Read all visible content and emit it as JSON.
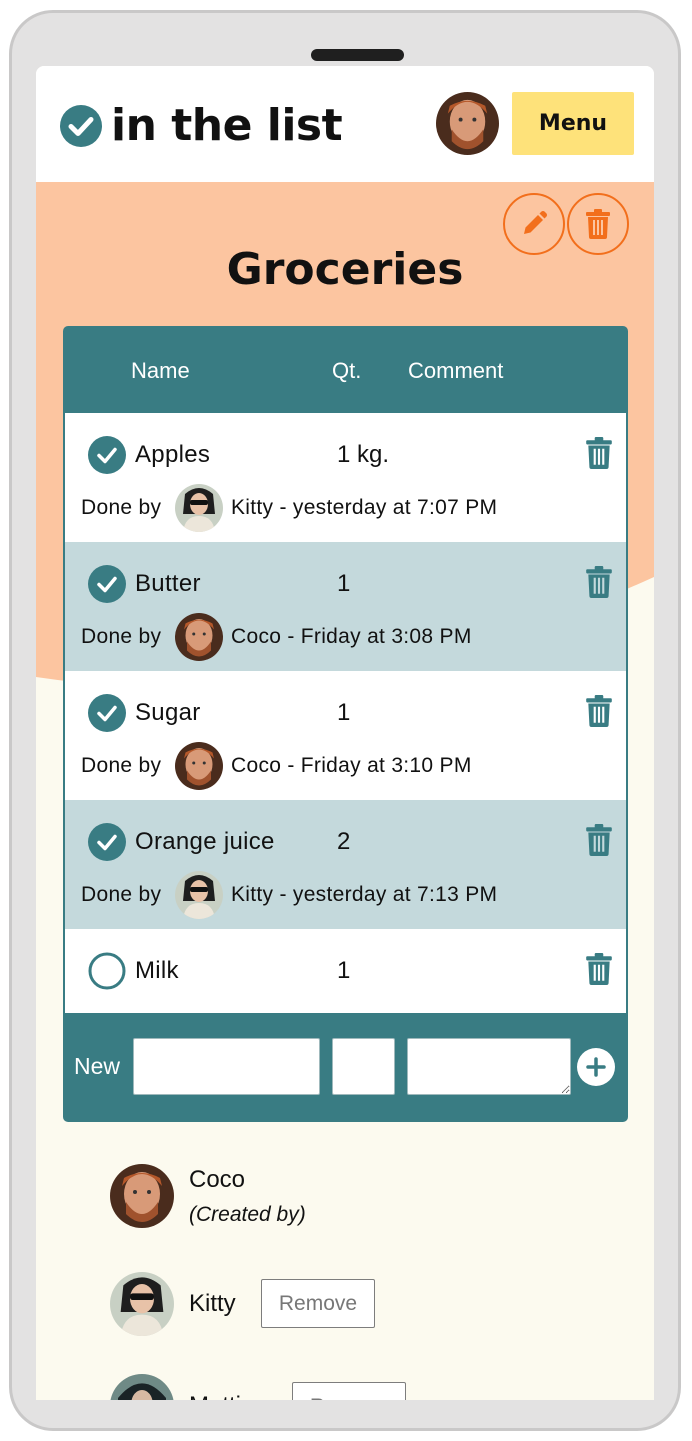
{
  "app": {
    "logo_text": "in the list",
    "menu_label": "Menu"
  },
  "list": {
    "title": "Groceries",
    "edit_icon": "pencil-icon",
    "delete_icon": "trash-icon"
  },
  "table": {
    "headers": {
      "name": "Name",
      "qty": "Qt.",
      "comment": "Comment"
    },
    "done_by_label": "Done by",
    "items": [
      {
        "name": "Apples",
        "qty": "1 kg.",
        "done": true,
        "done_text": "Kitty - yesterday at 7:07 PM"
      },
      {
        "name": "Butter",
        "qty": "1",
        "done": true,
        "done_text": "Coco - Friday at 3:08 PM"
      },
      {
        "name": "Sugar",
        "qty": "1",
        "done": true,
        "done_text": "Coco - Friday at 3:10 PM"
      },
      {
        "name": "Orange juice",
        "qty": "2",
        "done": true,
        "done_text": "Kitty - yesterday at 7:13 PM"
      },
      {
        "name": "Milk",
        "qty": "1",
        "done": false,
        "done_text": ""
      }
    ],
    "new_row": {
      "label": "New",
      "name_value": "",
      "qty_value": "",
      "comment_value": ""
    }
  },
  "members": [
    {
      "name": "Coco",
      "subtitle": "(Created by)"
    },
    {
      "name": "Kitty",
      "remove_label": "Remove"
    },
    {
      "name": "Mattie",
      "remove_label": "Remove"
    }
  ],
  "colors": {
    "accent": "#397c83",
    "banner": "#fcc5a0",
    "menu_button": "#fee27a",
    "action_orange": "#f26f1c",
    "row_alt": "#c4d9dc",
    "page_bg": "#fcfaef"
  }
}
